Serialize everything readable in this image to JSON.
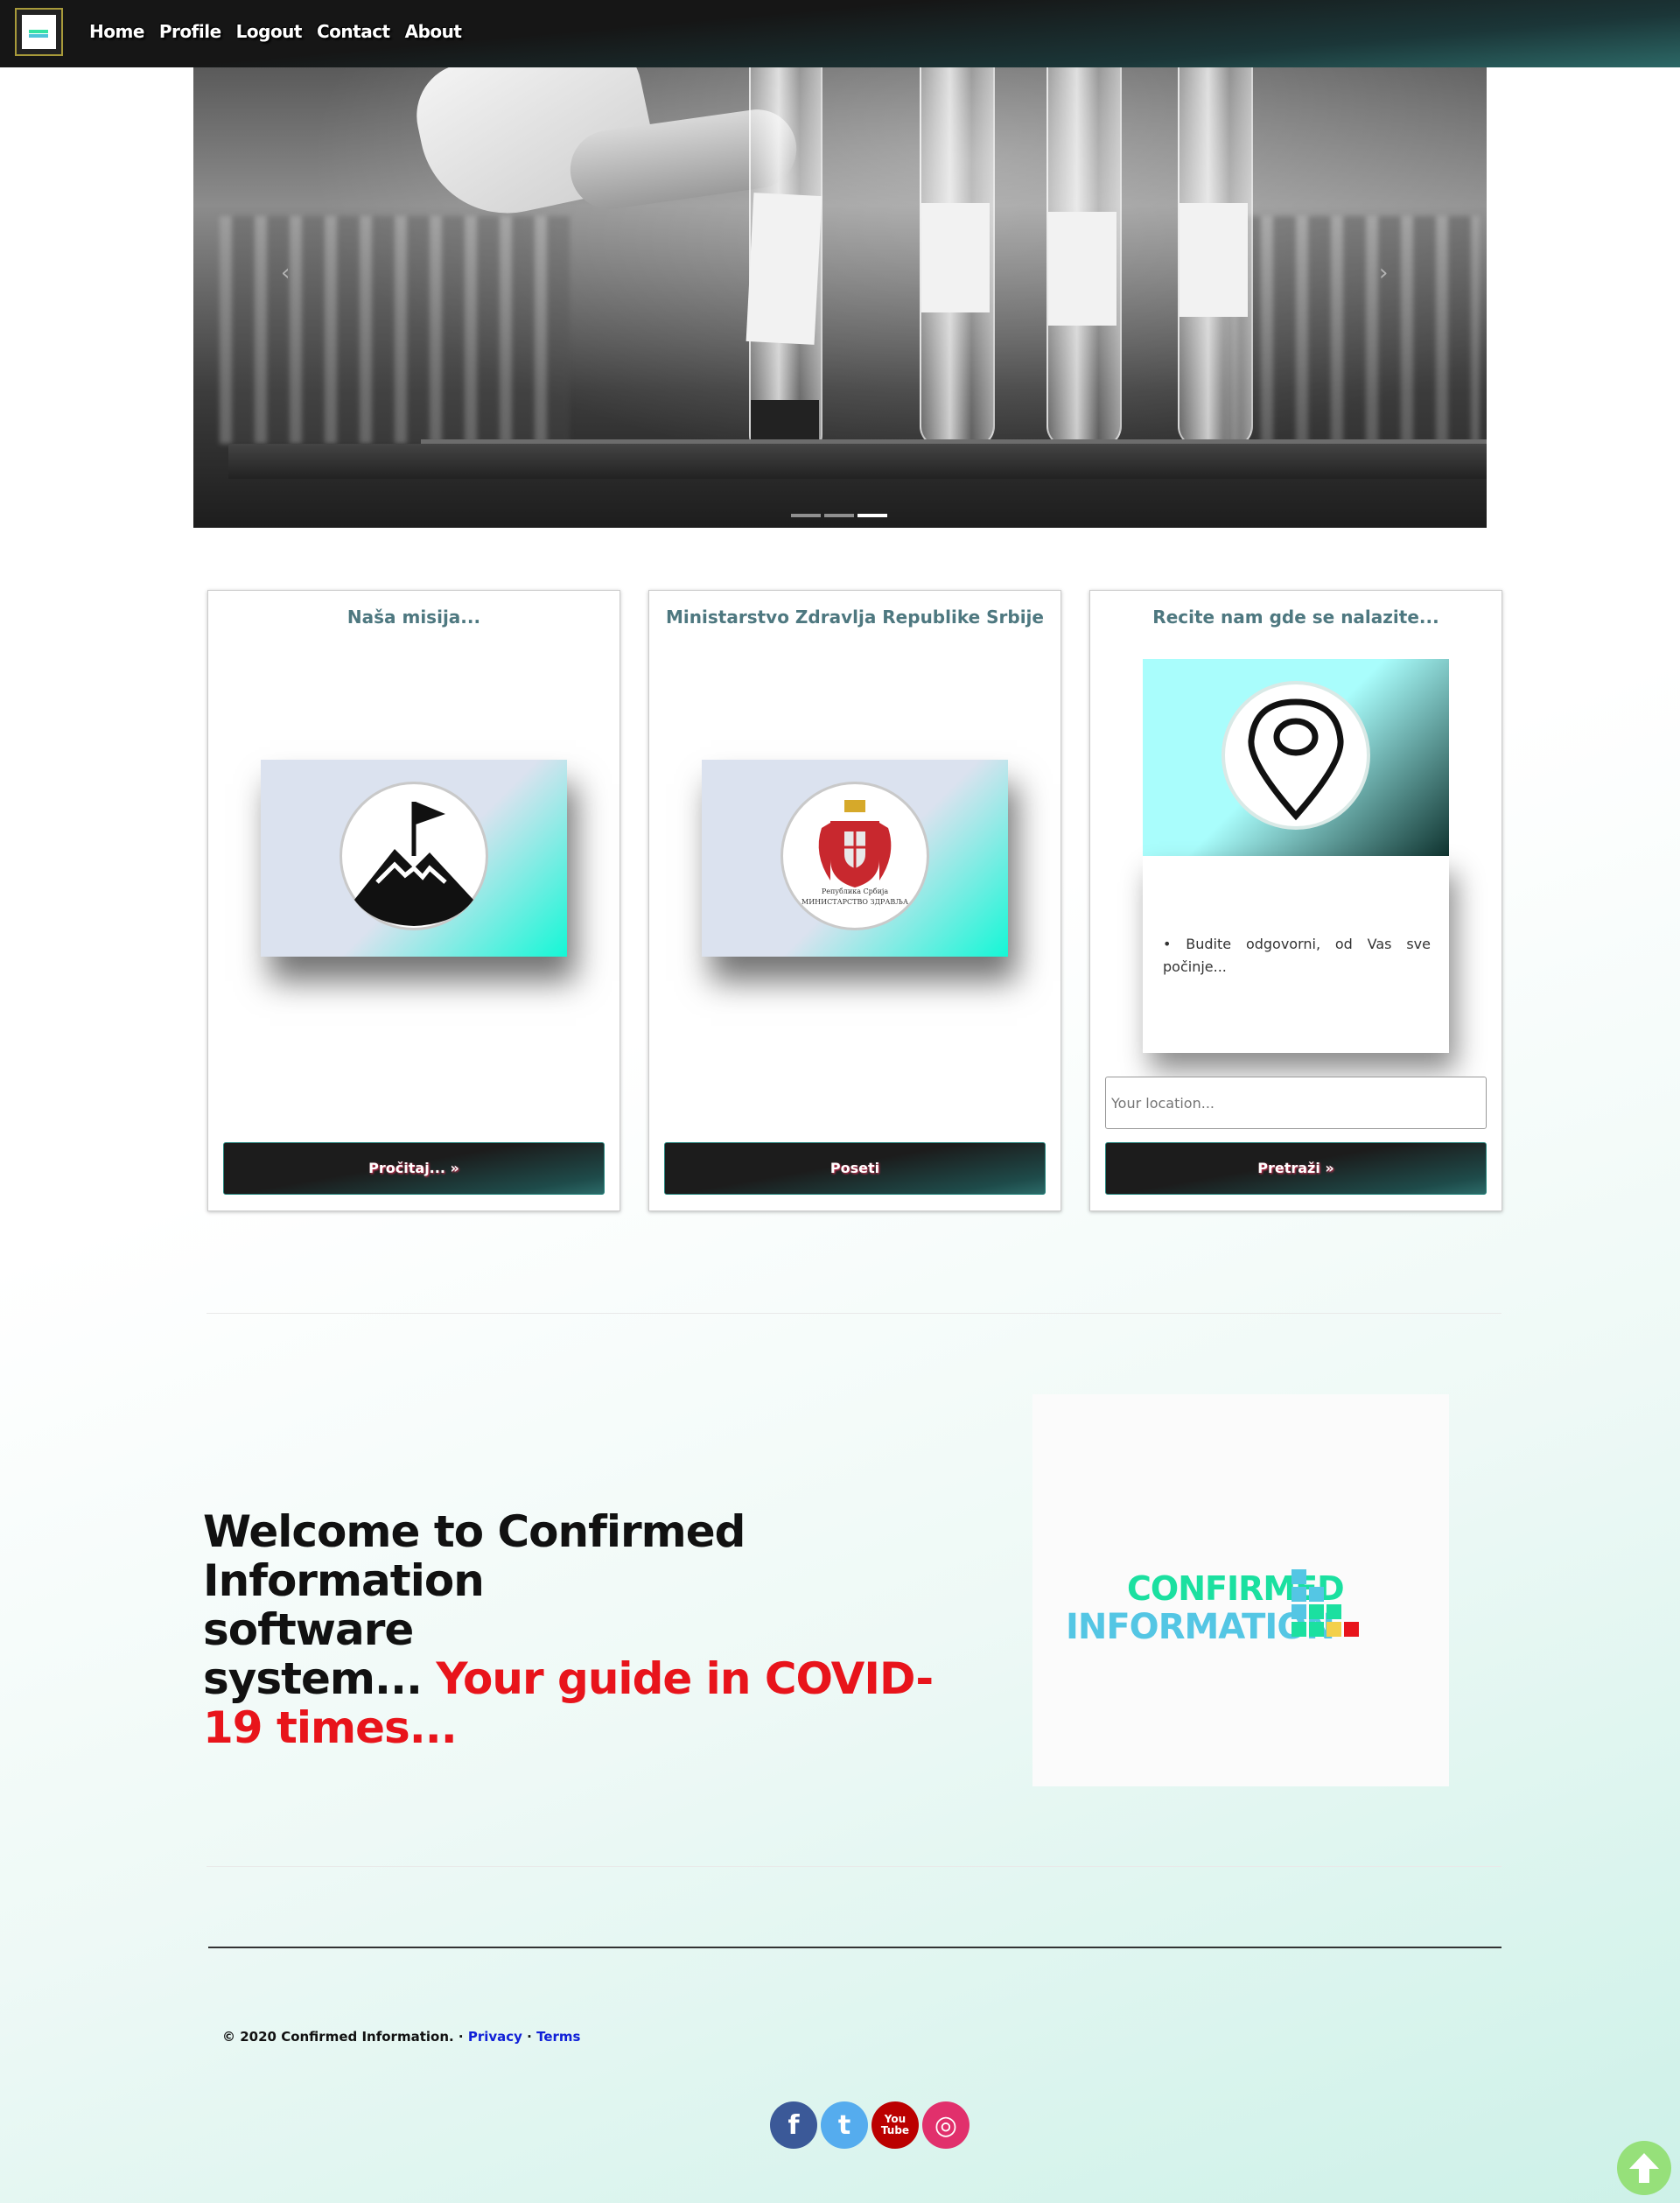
{
  "nav": {
    "links": [
      "Home",
      "Profile",
      "Logout",
      "Contact",
      "About"
    ]
  },
  "carousel": {
    "prev_icon": "chevron-left-icon",
    "next_icon": "chevron-right-icon",
    "slide_count": 3,
    "active_index": 2
  },
  "cards": [
    {
      "title": "Naša misija...",
      "icon": "mountain-flag-icon",
      "button": "Pročitaj... »"
    },
    {
      "title": "Ministarstvo Zdravlja Republike Srbije",
      "icon": "serbia-coat-of-arms-icon",
      "emblem_line1": "Република Србија",
      "emblem_line2": "МИНИСТАРСТВО ЗДРАВЉА",
      "button": "Poseti"
    },
    {
      "title": "Recite nam gde se nalazite...",
      "icon": "map-pin-icon",
      "text": "• Budite odgovorni, od Vas sve počinje...",
      "input_placeholder": "Your location...",
      "button": "Pretraži »"
    }
  ],
  "welcome": {
    "line1": "Welcome to Confirmed Information",
    "line2": "software",
    "line3": "system... ",
    "highlight": "Your guide in COVID-19 times..."
  },
  "logo": {
    "line1": "CONFIRMED",
    "line2": "INFORMATION",
    "colors": {
      "teal": "#54c6e4",
      "green": "#1be0a0",
      "yellow": "#f3d04a",
      "red": "#e8141b"
    }
  },
  "footer": {
    "copyright": "© 2020 Confirmed Information. · ",
    "privacy": "Privacy",
    "sep": " · ",
    "terms": "Terms"
  },
  "social": [
    {
      "name": "facebook-icon",
      "glyph": "f",
      "color": "#3b5998"
    },
    {
      "name": "twitter-icon",
      "glyph": "t",
      "color": "#55acee"
    },
    {
      "name": "youtube-icon",
      "glyph": "You\nTube",
      "color": "#bb0000"
    },
    {
      "name": "instagram-icon",
      "glyph": "◎",
      "color": "#e1306c"
    }
  ],
  "scroll_top_icon": "arrow-up-icon"
}
